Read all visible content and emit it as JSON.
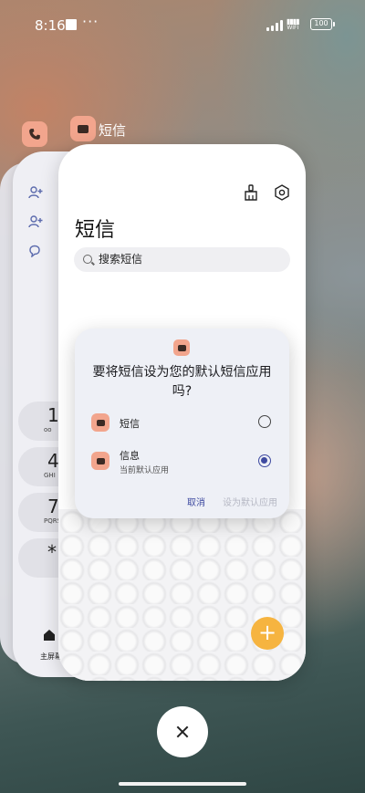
{
  "status_bar": {
    "time": "8:16",
    "overflow": "···",
    "network": "WIFI",
    "battery": "100"
  },
  "recent_apps": {
    "active_app_label": "短信",
    "close_all_label": "close"
  },
  "back_card": {
    "dial_keys": [
      {
        "num": "1",
        "sub": "oo"
      },
      {
        "num": "4",
        "sub": "GHI"
      },
      {
        "num": "7",
        "sub": "PQRS"
      },
      {
        "num": "*",
        "sub": ""
      }
    ],
    "home_label": "主屏幕"
  },
  "main_card": {
    "title": "短信",
    "search_placeholder": "搜索短信"
  },
  "dialog": {
    "title": "要将短信设为您的默认短信应用吗?",
    "options": [
      {
        "label": "短信",
        "sub": "",
        "selected": false
      },
      {
        "label": "信息",
        "sub": "当前默认应用",
        "selected": true
      }
    ],
    "cancel_label": "取消",
    "set_default_label": "设为默认应用"
  },
  "colors": {
    "accent": "#3e4aa0",
    "fab": "#f6b440",
    "app_icon": "#f2a58d"
  }
}
